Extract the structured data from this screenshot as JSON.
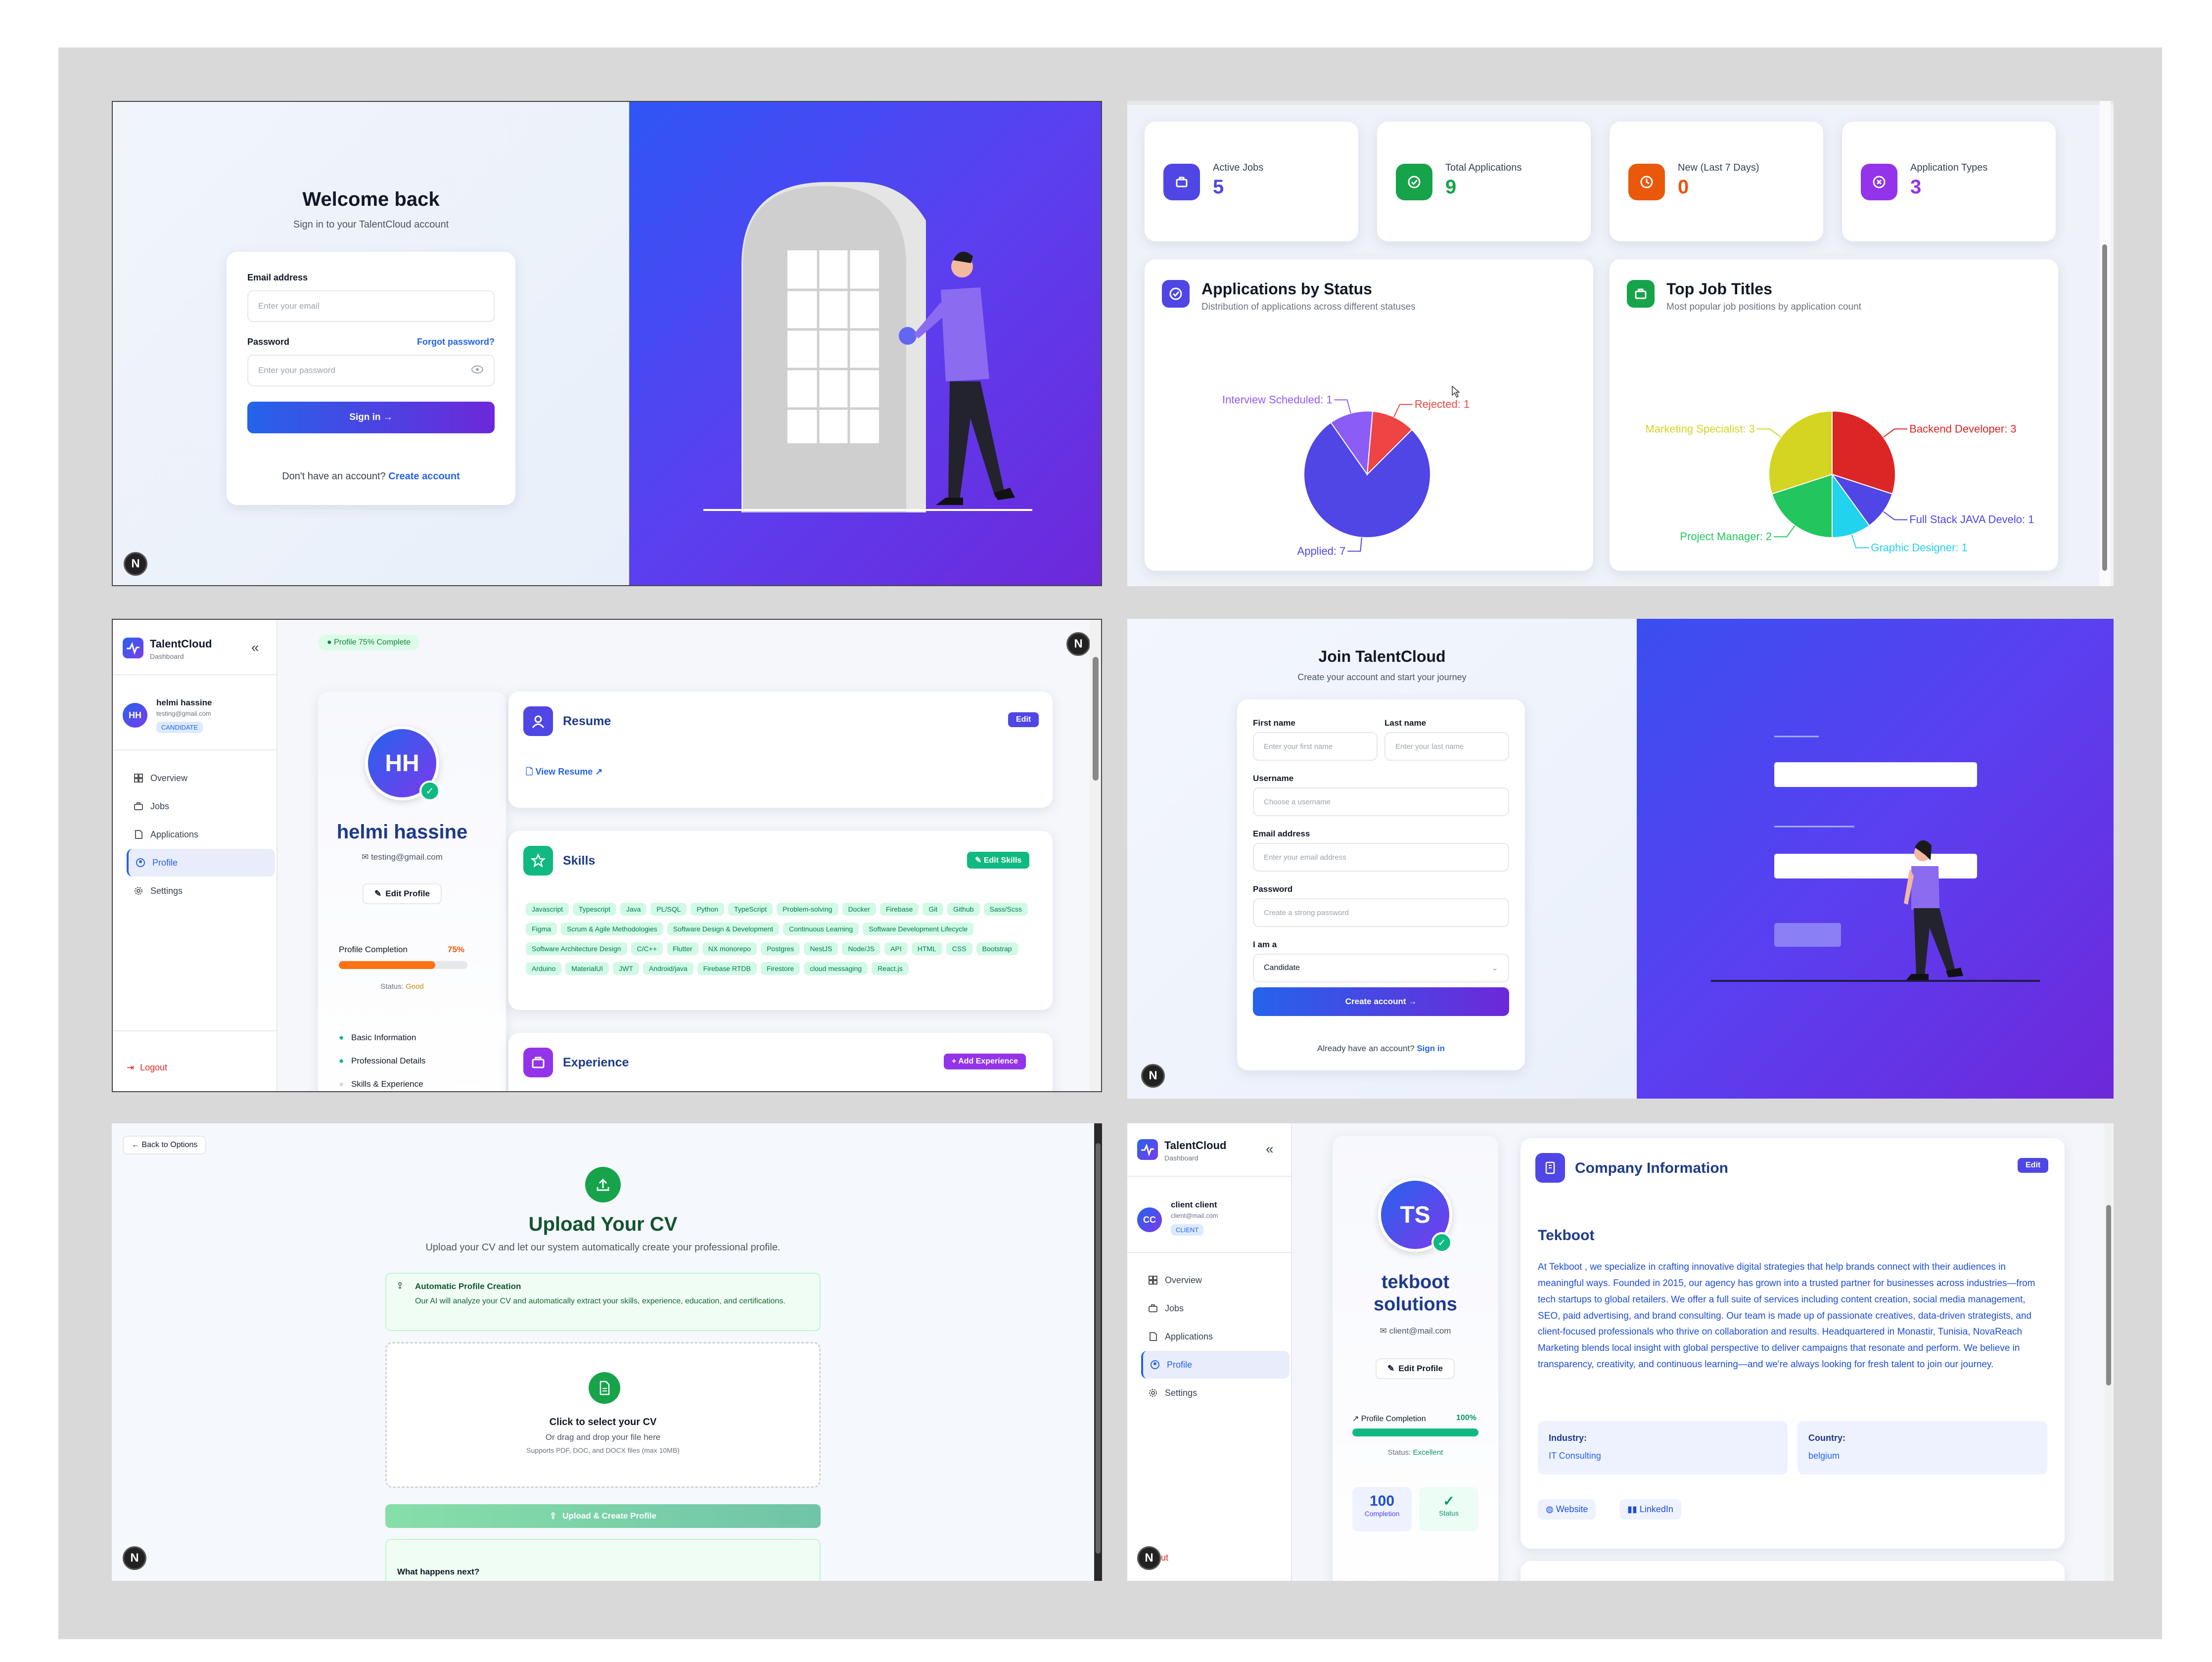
{
  "login": {
    "title": "Welcome back",
    "subtitle": "Sign in to your TalentCloud account",
    "email_label": "Email address",
    "email_placeholder": "Enter your email",
    "password_label": "Password",
    "forgot": "Forgot password?",
    "password_placeholder": "Enter your password",
    "signin": "Sign in →",
    "no_account": "Don't have an account? ",
    "create": "Create account"
  },
  "dashboard": {
    "stats": [
      {
        "label": "Active Jobs",
        "value": "5",
        "color": "#4f46e5",
        "icon": "briefcase-icon"
      },
      {
        "label": "Total Applications",
        "value": "9",
        "color": "#16a34a",
        "icon": "check-circle-icon"
      },
      {
        "label": "New (Last 7 Days)",
        "value": "0",
        "color": "#ea580c",
        "icon": "clock-icon"
      },
      {
        "label": "Application Types",
        "value": "3",
        "color": "#9333ea",
        "icon": "x-circle-icon"
      }
    ],
    "status_title": "Applications by Status",
    "status_sub": "Distribution of applications across different statuses",
    "titles_title": "Top Job Titles",
    "titles_sub": "Most popular job positions by application count"
  },
  "chart_data": [
    {
      "type": "pie",
      "title": "Applications by Status",
      "slices": [
        {
          "label": "Applied",
          "value": 7,
          "color": "#4f46e5"
        },
        {
          "label": "Interview Scheduled",
          "value": 1,
          "color": "#8b5cf6"
        },
        {
          "label": "Rejected",
          "value": 1,
          "color": "#ef4444"
        }
      ]
    },
    {
      "type": "pie",
      "title": "Top Job Titles",
      "slices": [
        {
          "label": "Backend Developer",
          "value": 3,
          "color": "#dc2626"
        },
        {
          "label": "Full Stack JAVA Develo",
          "value": 1,
          "color": "#4f46e5"
        },
        {
          "label": "Graphic Designer",
          "value": 1,
          "color": "#22d3ee"
        },
        {
          "label": "Project Manager",
          "value": 2,
          "color": "#22c55e"
        },
        {
          "label": "Marketing Specialist",
          "value": 3,
          "color": "#d4d422"
        }
      ]
    }
  ],
  "profile": {
    "brand": "TalentCloud",
    "brand_sub": "Dashboard",
    "user_name": "helmi hassine",
    "user_email": "testing@gmail.com",
    "role": "CANDIDATE",
    "initials": "HH",
    "nav": [
      "Overview",
      "Jobs",
      "Applications",
      "Profile",
      "Settings"
    ],
    "logout": "Logout",
    "completion_badge": "Profile 75% Complete",
    "name": "helmi hassine",
    "email": "testing@gmail.com",
    "edit_profile": "Edit Profile",
    "completion_label": "Profile Completion",
    "completion_value": "75%",
    "completion_fraction": 0.75,
    "status_label": "Status: ",
    "status_value": "Good",
    "checklist": [
      "Basic Information",
      "Professional Details",
      "Skills & Experience"
    ],
    "resume_title": "Resume",
    "resume_edit": "Edit",
    "view_resume": "View Resume",
    "skills_title": "Skills",
    "edit_skills": "Edit Skills",
    "skills": [
      "Javascript",
      "Typescript",
      "Java",
      "PL/SQL",
      "Python",
      "TypeScript",
      "Problem-solving",
      "Docker",
      "Firebase",
      "Git",
      "Github",
      "Sass/Scss",
      "Figma",
      "Scrum & Agile Methodologies",
      "Software Design & Development",
      "Continuous Learning",
      "Software Development Lifecycle",
      "Software Architecture Design",
      "C/C++",
      "Flutter",
      "NX monorepo",
      "Postgres",
      "NestJS",
      "Node/JS",
      "API",
      "HTML",
      "CSS",
      "Bootstrap",
      "Arduino",
      "MaterialUI",
      "JWT",
      "Android/java",
      "Firebase RTDB",
      "Firestore",
      "cloud messaging",
      "React.js"
    ],
    "experience_title": "Experience",
    "add_experience": "+ Add Experience"
  },
  "register": {
    "title": "Join TalentCloud",
    "subtitle": "Create your account and start your journey",
    "first_label": "First name",
    "first_ph": "Enter your first name",
    "last_label": "Last name",
    "last_ph": "Enter your last name",
    "username_label": "Username",
    "username_ph": "Choose a username",
    "email_label": "Email address",
    "email_ph": "Enter your email address",
    "password_label": "Password",
    "password_ph": "Create a strong password",
    "iam_label": "I am a",
    "iam_value": "Candidate",
    "create": "Create account →",
    "have_account": "Already have an account? ",
    "signin": "Sign in"
  },
  "upload": {
    "back": "Back to Options",
    "title": "Upload Your CV",
    "subtitle": "Upload your CV and let our system automatically create your professional profile.",
    "auto_title": "Automatic Profile Creation",
    "auto_desc": "Our AI will analyze your CV and automatically extract your skills, experience, education, and certifications.",
    "drop_title": "Click to select your CV",
    "drop_sub": "Or drag and drop your file here",
    "drop_hint": "Supports PDF, DOC, and DOCX files (max 10MB)",
    "button": "Upload & Create Profile",
    "next": "What happens next?"
  },
  "company": {
    "brand": "TalentCloud",
    "brand_sub": "Dashboard",
    "user_name": "client client",
    "user_email": "client@mail.com",
    "role": "CLIENT",
    "initials": "CC",
    "nav": [
      "Overview",
      "Jobs",
      "Applications",
      "Profile",
      "Settings"
    ],
    "logout": "Logout",
    "avatar": "TS",
    "name_line1": "tekboot",
    "name_line2": "solutions",
    "email": "client@mail.com",
    "edit_profile": "Edit Profile",
    "completion_label": "Profile Completion",
    "completion_value": "100%",
    "completion_fraction": 1.0,
    "status_label": "Status: ",
    "status_value": "Excellent",
    "stat1_value": "100",
    "stat1_label": "Completion",
    "stat2_label": "Status",
    "info_title": "Company Information",
    "edit": "Edit",
    "company_name": "Tekboot",
    "description": "At Tekboot , we specialize in crafting innovative digital strategies that help brands connect with their audiences in meaningful ways. Founded in 2015, our agency has grown into a trusted partner for businesses across industries—from tech startups to global retailers. We offer a full suite of services including content creation, social media management, SEO, paid advertising, and brand consulting. Our team is made up of passionate creatives, data-driven strategists, and client-focused professionals who thrive on collaboration and results. Headquartered in Monastir, Tunisia, NovaReach Marketing blends local insight with global perspective to deliver campaigns that resonate and perform. We believe in transparency, creativity, and continuous learning—and we're always looking for fresh talent to join our journey.",
    "industry_label": "Industry:",
    "industry": "IT Consulting",
    "country_label": "Country:",
    "country": "belgium",
    "website": "Website",
    "linkedin": "LinkedIn"
  }
}
